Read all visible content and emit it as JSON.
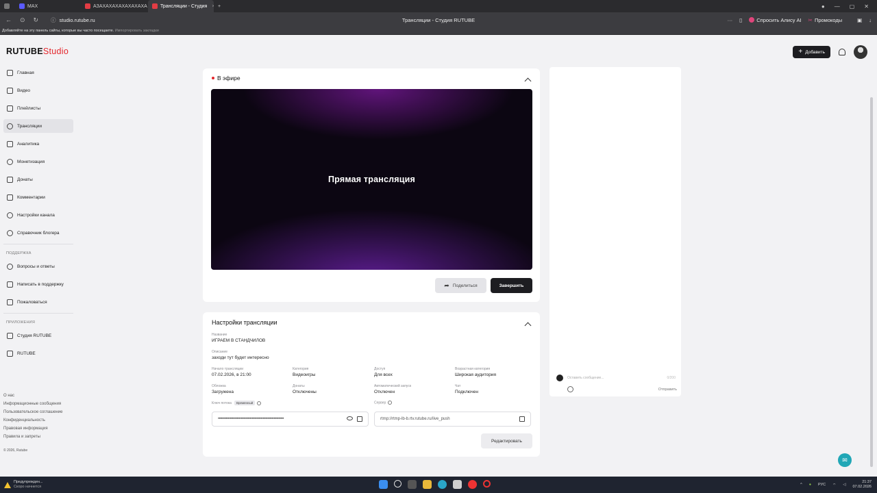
{
  "browser": {
    "tabs": [
      {
        "label": "MAX",
        "active": false
      },
      {
        "label": "АЗАХАХАХАХАХАХАХА",
        "active": false
      },
      {
        "label": "Трансляции - Студия",
        "active": true
      }
    ],
    "url": "studio.rutube.ru",
    "page_title": "Трансляции - Студия RUTUBE",
    "alice_label": "Спросить Алису AI",
    "promo_label": "Промокоды",
    "bookmark_hint": "Добавляйте на эту панель сайты, которые вы часто посещаете.",
    "bookmark_import": "Импортировать закладки"
  },
  "logo": {
    "brand": "RUTUBE",
    "suffix": "Studio"
  },
  "sidebar": {
    "items": [
      {
        "label": "Главная"
      },
      {
        "label": "Видео"
      },
      {
        "label": "Плейлисты"
      },
      {
        "label": "Трансляции"
      },
      {
        "label": "Аналитика"
      },
      {
        "label": "Монетизация"
      },
      {
        "label": "Донаты"
      },
      {
        "label": "Комментарии"
      },
      {
        "label": "Настройки канала"
      },
      {
        "label": "Справочник блогера"
      }
    ],
    "support_title": "ПОДДЕРЖКА",
    "support_items": [
      {
        "label": "Вопросы и ответы"
      },
      {
        "label": "Написать в поддержку"
      },
      {
        "label": "Пожаловаться"
      }
    ],
    "apps_title": "ПРИЛОЖЕНИЯ",
    "apps_items": [
      {
        "label": "Студия RUTUBE"
      },
      {
        "label": "RUTUBE"
      }
    ],
    "footer": [
      "О нас",
      "Информационные сообщения",
      "Пользовательское соглашение",
      "Конфиденциальность",
      "Правовая информация",
      "Правила и запреты"
    ],
    "copyright": "© 2026, Rutube"
  },
  "header": {
    "add_label": "Добавить"
  },
  "live": {
    "status": "В эфире",
    "player_label": "Прямая трансляция",
    "share_label": "Поделиться",
    "end_label": "Завершить"
  },
  "settings": {
    "title": "Настройки трансляции",
    "name_label": "Название",
    "name_value": "ИГРАЕМ В СТАНДЧИЛОВ",
    "desc_label": "Описание",
    "desc_value": "заходи тут будет интересно",
    "start_label": "Начало трансляции",
    "start_value": "07.02.2026, в 21:00",
    "category_label": "Категория",
    "category_value": "Видеоигры",
    "access_label": "Доступ",
    "access_value": "Для всех",
    "age_label": "Возрастная категория",
    "age_value": "Широкая аудитория",
    "cover_label": "Обложка",
    "cover_value": "Загружена",
    "donates_label": "Донаты",
    "donates_value": "Отключены",
    "autostart_label": "Автоматический запуск",
    "autostart_value": "Отключен",
    "chat_label": "Чат",
    "chat_value": "Подключен",
    "key_label": "Ключ потока",
    "key_badge": "Временный",
    "key_value": "••••••••••••••••••••••••••••••••••••••••••••••••••••••••••••",
    "server_label": "Сервер",
    "server_value": "rtmp://rtmp-lb-b.rtv.rutube.ru/live_push",
    "edit_label": "Редактировать"
  },
  "chat": {
    "placeholder": "Оставить сообщение...",
    "counter": "0/200",
    "send_label": "Отправить"
  },
  "taskbar": {
    "notif_title": "Предупрежден...",
    "notif_sub": "Скоро начнется",
    "lang": "РУС",
    "time": "21:37",
    "date": "07.02.2026"
  }
}
